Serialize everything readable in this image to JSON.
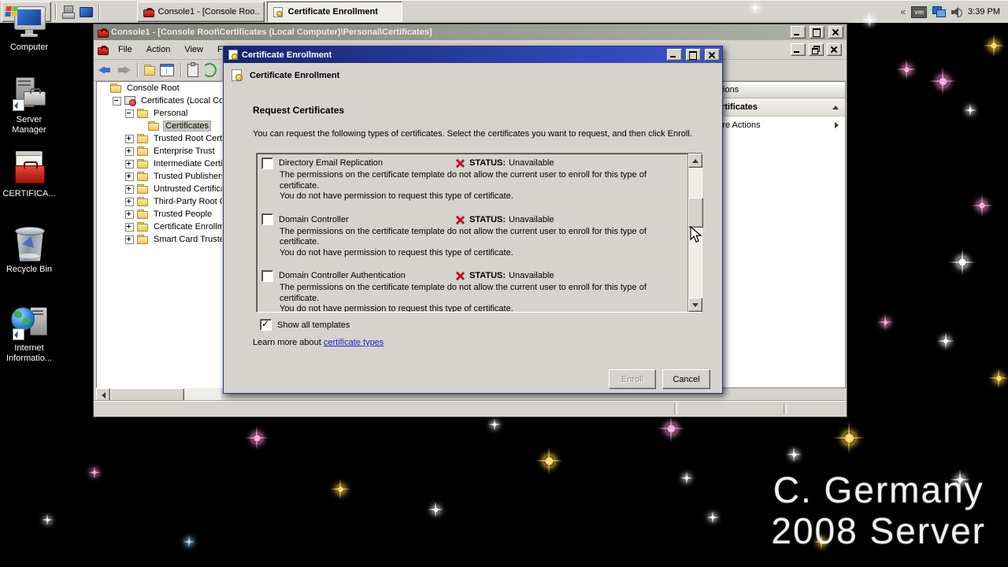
{
  "desktop": {
    "icons": [
      {
        "label": "Computer"
      },
      {
        "label": "Server Manager"
      },
      {
        "label": "CERTIFICA..."
      },
      {
        "label": "Recycle Bin"
      },
      {
        "label": "Internet Informatio..."
      }
    ],
    "watermark_line1": "C. Germany",
    "watermark_line2": "2008 Server"
  },
  "mmc": {
    "title": "Console1 - [Console Root\\Certificates (Local Computer)\\Personal\\Certificates]",
    "menus": [
      "File",
      "Action",
      "View",
      "Favorites"
    ],
    "tree": [
      {
        "label": "Console Root",
        "level": 0,
        "expand": "none",
        "icon": "folder",
        "selected": false
      },
      {
        "label": "Certificates (Local Comp",
        "level": 1,
        "expand": "minus",
        "icon": "certstore",
        "selected": false
      },
      {
        "label": "Personal",
        "level": 2,
        "expand": "minus",
        "icon": "folder",
        "selected": false
      },
      {
        "label": "Certificates",
        "level": 3,
        "expand": "none",
        "icon": "folder",
        "selected": true
      },
      {
        "label": "Trusted Root Certif",
        "level": 2,
        "expand": "plus",
        "icon": "folder",
        "selected": false
      },
      {
        "label": "Enterprise Trust",
        "level": 2,
        "expand": "plus",
        "icon": "folder",
        "selected": false
      },
      {
        "label": "Intermediate Certif",
        "level": 2,
        "expand": "plus",
        "icon": "folder",
        "selected": false
      },
      {
        "label": "Trusted Publishers",
        "level": 2,
        "expand": "plus",
        "icon": "folder",
        "selected": false
      },
      {
        "label": "Untrusted Certifica",
        "level": 2,
        "expand": "plus",
        "icon": "folder",
        "selected": false
      },
      {
        "label": "Third-Party Root Ce",
        "level": 2,
        "expand": "plus",
        "icon": "folder",
        "selected": false
      },
      {
        "label": "Trusted People",
        "level": 2,
        "expand": "plus",
        "icon": "folder",
        "selected": false
      },
      {
        "label": "Certificate Enrollme",
        "level": 2,
        "expand": "plus",
        "icon": "folder",
        "selected": false
      },
      {
        "label": "Smart Card Trusted",
        "level": 2,
        "expand": "plus",
        "icon": "folder",
        "selected": false
      }
    ],
    "actions_pane": {
      "header": "Actions",
      "section": "Certificates",
      "more_actions": "More Actions"
    }
  },
  "dialog": {
    "title": "Certificate Enrollment",
    "header": "Certificate Enrollment",
    "heading": "Request Certificates",
    "description": "You can request the following types of certificates. Select the certificates you want to request, and then click Enroll.",
    "items": [
      {
        "name": "Directory Email Replication",
        "status_label": "STATUS:",
        "status_value": "Unavailable",
        "desc": "The permissions on the certificate template do not allow the current user to enroll for this type of certificate.",
        "desc2": "You do not have permission to request this type of certificate.",
        "checked": false
      },
      {
        "name": "Domain Controller",
        "status_label": "STATUS:",
        "status_value": "Unavailable",
        "desc": "The permissions on the certificate template do not allow the current user to enroll for this type of certificate.",
        "desc2": "You do not have permission to request this type of certificate.",
        "checked": false
      },
      {
        "name": "Domain Controller Authentication",
        "status_label": "STATUS:",
        "status_value": "Unavailable",
        "desc": "The permissions on the certificate template do not allow the current user to enroll for this type of certificate.",
        "desc2": "You do not have permission to request this type of certificate.",
        "checked": false
      }
    ],
    "show_all_label": "Show all templates",
    "show_all_checked": true,
    "learn_more_prefix": "Learn more about ",
    "learn_more_link": "certificate types",
    "enroll_label": "Enroll",
    "cancel_label": "Cancel"
  },
  "taskbar": {
    "start_label": "Start",
    "window_buttons": [
      {
        "label": "Console1 - [Console Roo...",
        "active": false
      },
      {
        "label": "Certificate Enrollment",
        "active": true
      }
    ],
    "tray": {
      "overflow_chevron": "«",
      "vm_label": "vm",
      "time": "3:39 PM"
    }
  },
  "colors": {
    "classic_face": "#d6d3ce",
    "active_title_start": "#17246d",
    "active_title_end": "#3d55c5",
    "inactive_title": "#82857d",
    "status_red_x": "#bd1a27",
    "link_blue": "#2222cc",
    "desktop_black": "#000000"
  }
}
